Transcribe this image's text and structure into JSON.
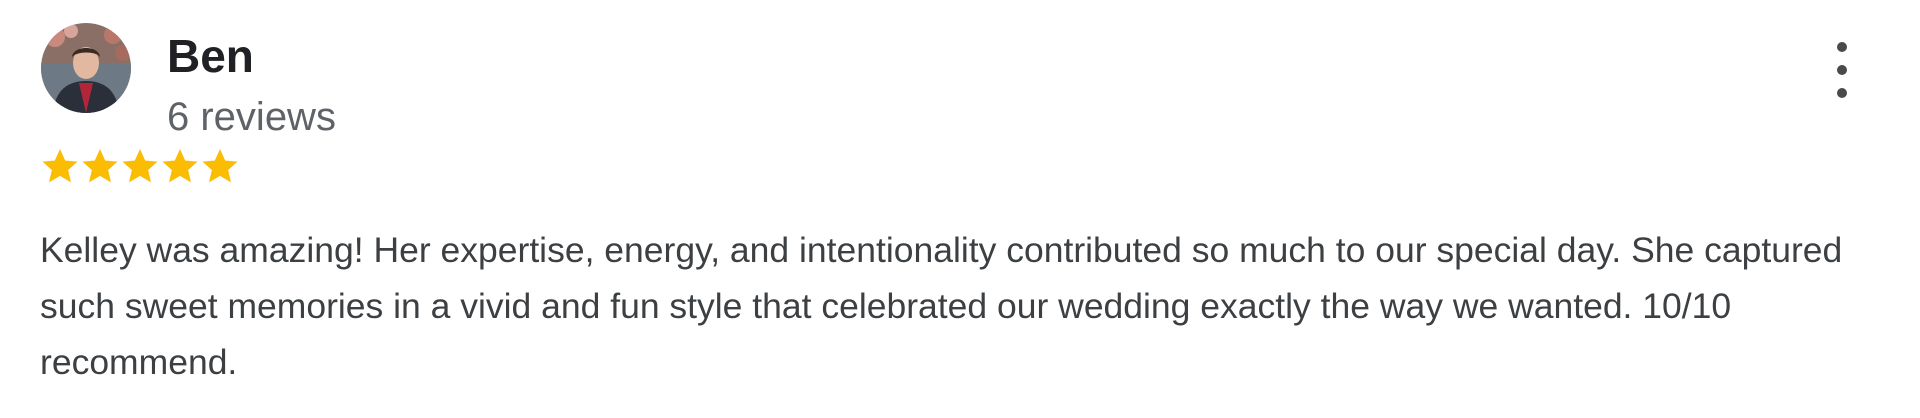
{
  "review": {
    "reviewer_name": "Ben",
    "review_count": "6 reviews",
    "rating": 5,
    "rating_max": 5,
    "star_color": "#fbbc04",
    "text": "Kelley was amazing! Her expertise, energy, and intentionality contributed so much to our special day. She captured such sweet memories in a vivid and fun style that celebrated our wedding exactly the way we wanted. 10/10 recommend.",
    "menu_icon": "more-vert-icon"
  }
}
